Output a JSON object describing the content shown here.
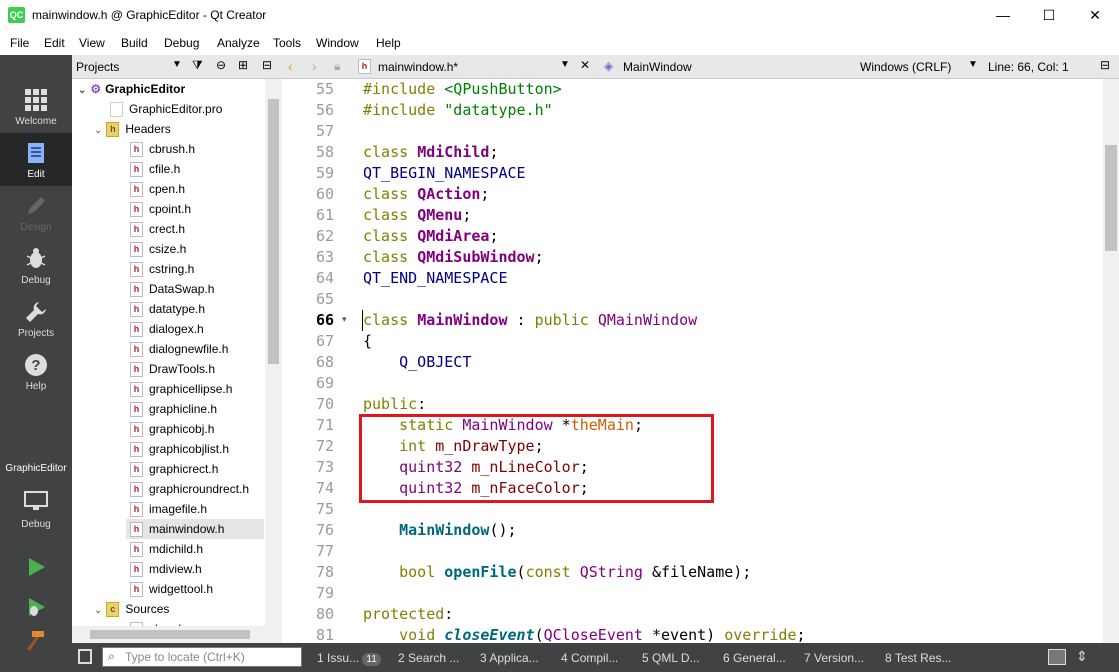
{
  "window": {
    "title": "mainwindow.h @ GraphicEditor - Qt Creator",
    "app_icon": "QC",
    "controls": [
      "—",
      "☐",
      "✕"
    ]
  },
  "menu": [
    "File",
    "Edit",
    "View",
    "Build",
    "Debug",
    "Analyze",
    "Tools",
    "Window",
    "Help"
  ],
  "modes": [
    {
      "label": "Welcome",
      "icon": "grid-icon",
      "state": "normal"
    },
    {
      "label": "Edit",
      "icon": "document-icon",
      "state": "active"
    },
    {
      "label": "Design",
      "icon": "pencil-icon",
      "state": "disabled"
    },
    {
      "label": "Debug",
      "icon": "bug-icon",
      "state": "normal"
    },
    {
      "label": "Projects",
      "icon": "wrench-icon",
      "state": "normal"
    },
    {
      "label": "Help",
      "icon": "help-icon",
      "state": "normal"
    }
  ],
  "kit": {
    "project": "GraphicEditor",
    "config": "Debug"
  },
  "sidebar": {
    "title": "Projects",
    "tree": [
      {
        "label": "GraphicEditor",
        "kind": "project",
        "depth": 0,
        "bold": true
      },
      {
        "label": "GraphicEditor.pro",
        "kind": "pro",
        "depth": 1
      },
      {
        "label": "Headers",
        "kind": "folder",
        "depth": 1
      },
      {
        "label": "cbrush.h",
        "kind": "h",
        "depth": 2
      },
      {
        "label": "cfile.h",
        "kind": "h",
        "depth": 2
      },
      {
        "label": "cpen.h",
        "kind": "h",
        "depth": 2
      },
      {
        "label": "cpoint.h",
        "kind": "h",
        "depth": 2
      },
      {
        "label": "crect.h",
        "kind": "h",
        "depth": 2
      },
      {
        "label": "csize.h",
        "kind": "h",
        "depth": 2
      },
      {
        "label": "cstring.h",
        "kind": "h",
        "depth": 2
      },
      {
        "label": "DataSwap.h",
        "kind": "h",
        "depth": 2
      },
      {
        "label": "datatype.h",
        "kind": "h",
        "depth": 2
      },
      {
        "label": "dialogex.h",
        "kind": "h",
        "depth": 2
      },
      {
        "label": "dialognewfile.h",
        "kind": "h",
        "depth": 2
      },
      {
        "label": "DrawTools.h",
        "kind": "h",
        "depth": 2
      },
      {
        "label": "graphicellipse.h",
        "kind": "h",
        "depth": 2
      },
      {
        "label": "graphicline.h",
        "kind": "h",
        "depth": 2
      },
      {
        "label": "graphicobj.h",
        "kind": "h",
        "depth": 2
      },
      {
        "label": "graphicobjlist.h",
        "kind": "h",
        "depth": 2
      },
      {
        "label": "graphicrect.h",
        "kind": "h",
        "depth": 2
      },
      {
        "label": "graphicroundrect.h",
        "kind": "h",
        "depth": 2
      },
      {
        "label": "imagefile.h",
        "kind": "h",
        "depth": 2
      },
      {
        "label": "mainwindow.h",
        "kind": "h",
        "depth": 2,
        "selected": true
      },
      {
        "label": "mdichild.h",
        "kind": "h",
        "depth": 2
      },
      {
        "label": "mdiview.h",
        "kind": "h",
        "depth": 2
      },
      {
        "label": "widgettool.h",
        "kind": "h",
        "depth": 2
      },
      {
        "label": "Sources",
        "kind": "folder",
        "depth": 1
      },
      {
        "label": "cbrush.cpp",
        "kind": "cpp",
        "depth": 2
      }
    ]
  },
  "editor": {
    "file_tab": "mainwindow.h*",
    "symbol": "MainWindow",
    "line_ending": "Windows (CRLF)",
    "position": "Line: 66, Col: 1",
    "current_line": 66,
    "lines": [
      {
        "n": 55,
        "t": [
          [
            "kw",
            "#include "
          ],
          [
            "str",
            "<QPushButton>"
          ]
        ]
      },
      {
        "n": 56,
        "t": [
          [
            "kw",
            "#include "
          ],
          [
            "str",
            "\"datatype.h\""
          ]
        ]
      },
      {
        "n": 57,
        "t": []
      },
      {
        "n": 58,
        "t": [
          [
            "kw",
            "class "
          ],
          [
            "tyb",
            "MdiChild"
          ],
          [
            "pl",
            ";"
          ]
        ]
      },
      {
        "n": 59,
        "t": [
          [
            "mac",
            "QT_BEGIN_NAMESPACE"
          ]
        ]
      },
      {
        "n": 60,
        "t": [
          [
            "kw",
            "class "
          ],
          [
            "tyb",
            "QAction"
          ],
          [
            "pl",
            ";"
          ]
        ]
      },
      {
        "n": 61,
        "t": [
          [
            "kw",
            "class "
          ],
          [
            "tyb",
            "QMenu"
          ],
          [
            "pl",
            ";"
          ]
        ]
      },
      {
        "n": 62,
        "t": [
          [
            "kw",
            "class "
          ],
          [
            "tyb",
            "QMdiArea"
          ],
          [
            "pl",
            ";"
          ]
        ]
      },
      {
        "n": 63,
        "t": [
          [
            "kw",
            "class "
          ],
          [
            "tyb",
            "QMdiSubWindow"
          ],
          [
            "pl",
            ";"
          ]
        ]
      },
      {
        "n": 64,
        "t": [
          [
            "mac",
            "QT_END_NAMESPACE"
          ]
        ]
      },
      {
        "n": 65,
        "t": []
      },
      {
        "n": 66,
        "t": [
          [
            "kw",
            "class "
          ],
          [
            "tyb",
            "MainWindow"
          ],
          [
            "pl",
            " : "
          ],
          [
            "kw",
            "public "
          ],
          [
            "ty",
            "QMainWindow"
          ]
        ]
      },
      {
        "n": 67,
        "t": [
          [
            "pl",
            "{"
          ]
        ]
      },
      {
        "n": 68,
        "t": [
          [
            "pl",
            "    "
          ],
          [
            "mac",
            "Q_OBJECT"
          ]
        ]
      },
      {
        "n": 69,
        "t": []
      },
      {
        "n": 70,
        "t": [
          [
            "kw",
            "public"
          ],
          [
            "pl",
            ":"
          ]
        ]
      },
      {
        "n": 71,
        "t": [
          [
            "pl",
            "    "
          ],
          [
            "kw",
            "static "
          ],
          [
            "ty",
            "MainWindow"
          ],
          [
            "pl",
            " *"
          ],
          [
            "stat",
            "theMain"
          ],
          [
            "pl",
            ";"
          ]
        ]
      },
      {
        "n": 72,
        "t": [
          [
            "pl",
            "    "
          ],
          [
            "kw",
            "int "
          ],
          [
            "var",
            "m_nDrawType"
          ],
          [
            "pl",
            ";"
          ]
        ]
      },
      {
        "n": 73,
        "t": [
          [
            "pl",
            "    "
          ],
          [
            "ty",
            "quint32 "
          ],
          [
            "var",
            "m_nLineColor"
          ],
          [
            "pl",
            ";"
          ]
        ]
      },
      {
        "n": 74,
        "t": [
          [
            "pl",
            "    "
          ],
          [
            "ty",
            "quint32 "
          ],
          [
            "var",
            "m_nFaceColor"
          ],
          [
            "pl",
            ";"
          ]
        ]
      },
      {
        "n": 75,
        "t": []
      },
      {
        "n": 76,
        "t": [
          [
            "pl",
            "    "
          ],
          [
            "fn",
            "MainWindow"
          ],
          [
            "pl",
            "();"
          ]
        ]
      },
      {
        "n": 77,
        "t": []
      },
      {
        "n": 78,
        "t": [
          [
            "pl",
            "    "
          ],
          [
            "kw",
            "bool "
          ],
          [
            "fn",
            "openFile"
          ],
          [
            "pl",
            "("
          ],
          [
            "kw",
            "const "
          ],
          [
            "ty",
            "QString"
          ],
          [
            "pl",
            " &"
          ],
          [
            "pl",
            "fileName);"
          ]
        ]
      },
      {
        "n": 79,
        "t": []
      },
      {
        "n": 80,
        "t": [
          [
            "kw",
            "protected"
          ],
          [
            "pl",
            ":"
          ]
        ]
      },
      {
        "n": 81,
        "t": [
          [
            "pl",
            "    "
          ],
          [
            "kw",
            "void "
          ],
          [
            "fni",
            "closeEvent"
          ],
          [
            "pl",
            "("
          ],
          [
            "ty",
            "QCloseEvent"
          ],
          [
            "pl",
            " *event) "
          ],
          [
            "kw",
            "override"
          ],
          [
            "pl",
            ";"
          ]
        ]
      }
    ]
  },
  "status": {
    "locate_placeholder": "Type to locate (Ctrl+K)",
    "panes": [
      {
        "num": "1",
        "label": "Issu...",
        "badge": "11"
      },
      {
        "num": "2",
        "label": "Search ..."
      },
      {
        "num": "3",
        "label": "Applica..."
      },
      {
        "num": "4",
        "label": "Compil..."
      },
      {
        "num": "5",
        "label": "QML D..."
      },
      {
        "num": "6",
        "label": "General..."
      },
      {
        "num": "7",
        "label": "Version..."
      },
      {
        "num": "8",
        "label": "Test Res..."
      }
    ]
  },
  "colors": {
    "highlight_box": "#e0161e",
    "modebar": "#404244",
    "keyword": "#808000",
    "type": "#800080",
    "string": "#008000"
  }
}
